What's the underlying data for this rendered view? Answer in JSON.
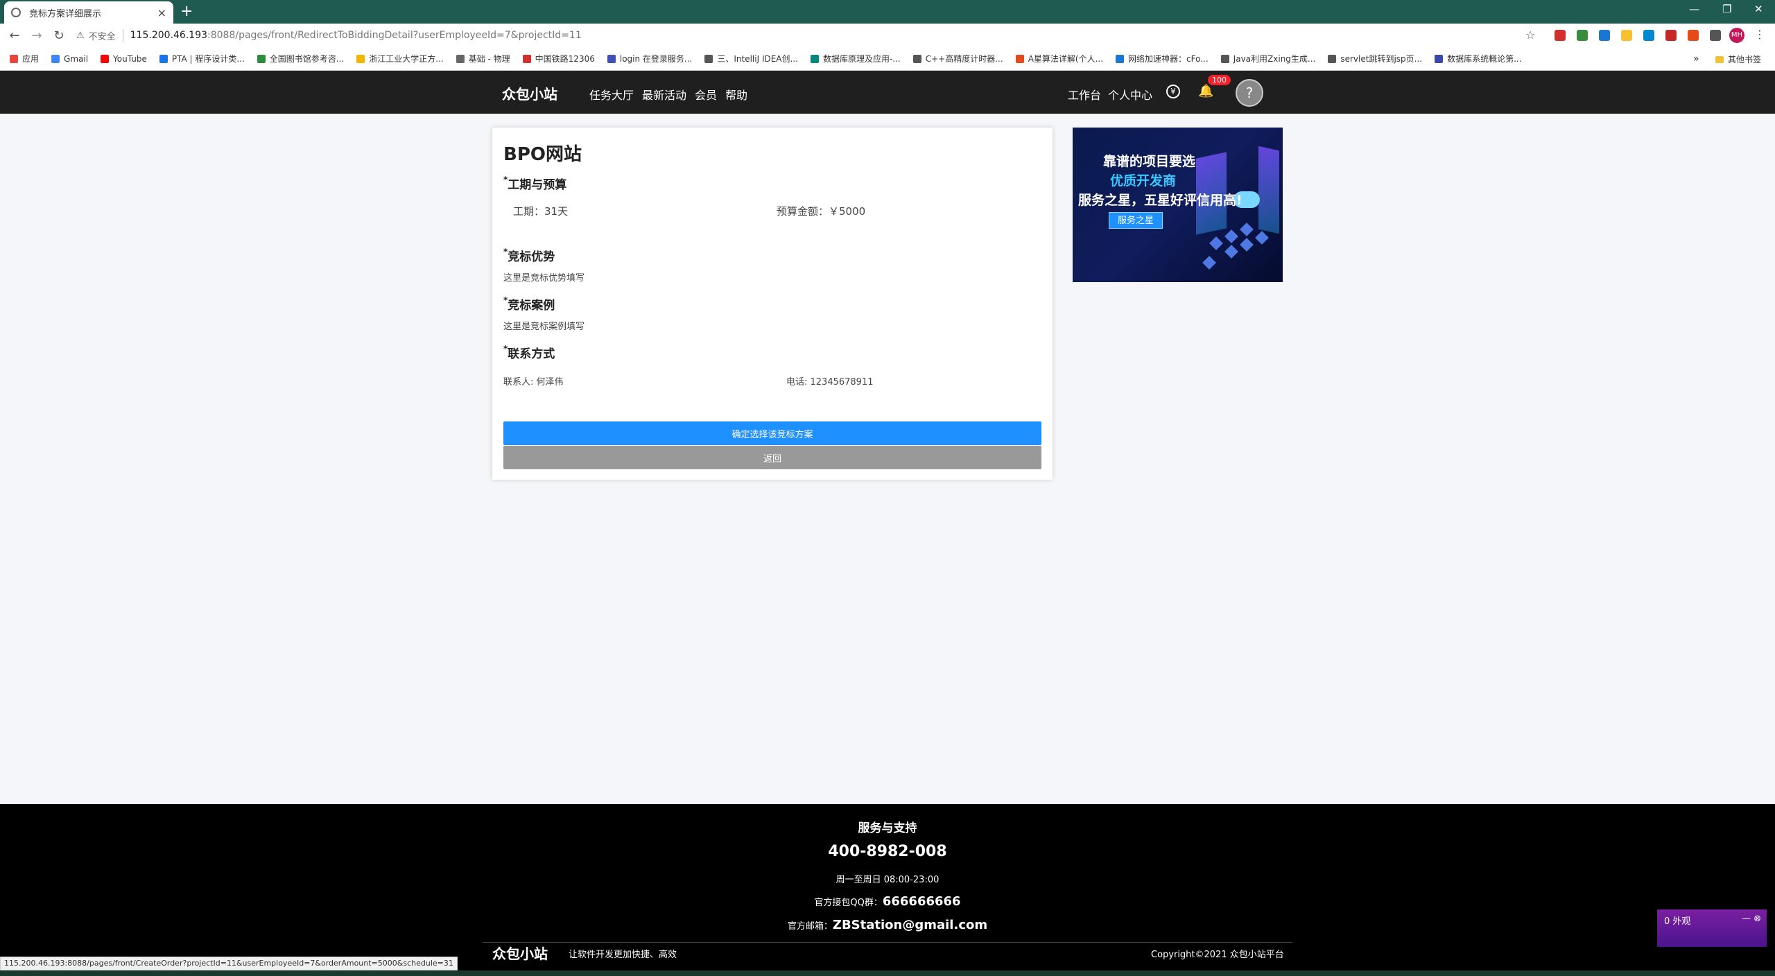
{
  "browser": {
    "tab_title": "竞标方案详细展示",
    "tab_close": "×",
    "new_tab": "+",
    "insecure_label": "不安全",
    "url_host": "115.200.46.193",
    "url_path": ":8088/pages/front/RedirectToBiddingDetail?userEmployeeId=7&projectId=11",
    "profile_initials": "MH",
    "window_minimize": "—",
    "window_restore": "❐",
    "window_close": "✕",
    "bookmarks": [
      {
        "label": "应用",
        "color": "#e8453c"
      },
      {
        "label": "Gmail",
        "color": "#4285f4"
      },
      {
        "label": "YouTube",
        "color": "#ff0000"
      },
      {
        "label": "PTA | 程序设计类...",
        "color": "#1a73e8"
      },
      {
        "label": "全国图书馆参考咨...",
        "color": "#2a8f3d"
      },
      {
        "label": "浙江工业大学正方...",
        "color": "#f4b400"
      },
      {
        "label": "基础 - 物理",
        "color": "#666666"
      },
      {
        "label": "中国铁路12306",
        "color": "#d32f2f"
      },
      {
        "label": "login 在登录服务...",
        "color": "#3f51b5"
      },
      {
        "label": "三、IntelliJ IDEA创...",
        "color": "#555555"
      },
      {
        "label": "数据库原理及应用-...",
        "color": "#00897b"
      },
      {
        "label": "C++高精度计时器...",
        "color": "#555555"
      },
      {
        "label": "A星算法详解(个人...",
        "color": "#e64a19"
      },
      {
        "label": "网络加速神器：cFo...",
        "color": "#1976d2"
      },
      {
        "label": "Java利用Zxing生成...",
        "color": "#555555"
      },
      {
        "label": "servlet跳转到jsp页...",
        "color": "#555555"
      },
      {
        "label": "数据库系统概论第...",
        "color": "#3949ab"
      }
    ],
    "bookmarks_more": "»",
    "bookmarks_other": "其他书签",
    "status_url": "115.200.46.193:8088/pages/front/CreateOrder?projectId=11&userEmployeeId=7&orderAmount=5000&schedule=31"
  },
  "header": {
    "logo": "众包小站",
    "nav": [
      "任务大厅",
      "最新活动",
      "会员",
      "帮助"
    ],
    "right_nav": [
      "工作台",
      "个人中心"
    ],
    "yen_symbol": "¥",
    "bell_symbol": "🔔",
    "notification_count": "100",
    "avatar_symbol": "?"
  },
  "card": {
    "project_title": "BPO网站",
    "required_mark": "*",
    "schedule_budget_heading": "工期与预算",
    "schedule": "工期：31天",
    "budget": "预算金额：￥5000",
    "advantage_heading": "竞标优势",
    "advantage_text": "这里是竞标优势填写",
    "case_heading": "竞标案例",
    "case_text": "这里是竞标案例填写",
    "contact_heading": "联系方式",
    "contact_person": "联系人: 何泽伟",
    "phone": "电话: 12345678911",
    "confirm_button": "确定选择该竞标方案",
    "back_button": "返回"
  },
  "ad": {
    "line1": "靠谱的项目要选",
    "line2": "优质开发商",
    "line3": "服务之星，五星好评信用高!",
    "button": "服务之星"
  },
  "footer": {
    "title": "服务与支持",
    "phone": "400-8982-008",
    "hours": "周一至周日 08:00-23:00",
    "qq_label": "官方接包QQ群：",
    "qq_value": "666666666",
    "mail_label": "官方邮箱：",
    "mail_value": "ZBStation@gmail.com",
    "logo": "众包小站",
    "slogan": "让软件开发更加快捷、高效",
    "copyright": "Copyright©2021 众包小站平台"
  },
  "widget": {
    "text": "0 外观",
    "controls": "— ⊗"
  },
  "colors": {
    "primary": "#1e90ff",
    "header_bg": "#1f1f1f",
    "footer_bg": "#000000",
    "tabbar_bg": "#1f5b51"
  }
}
